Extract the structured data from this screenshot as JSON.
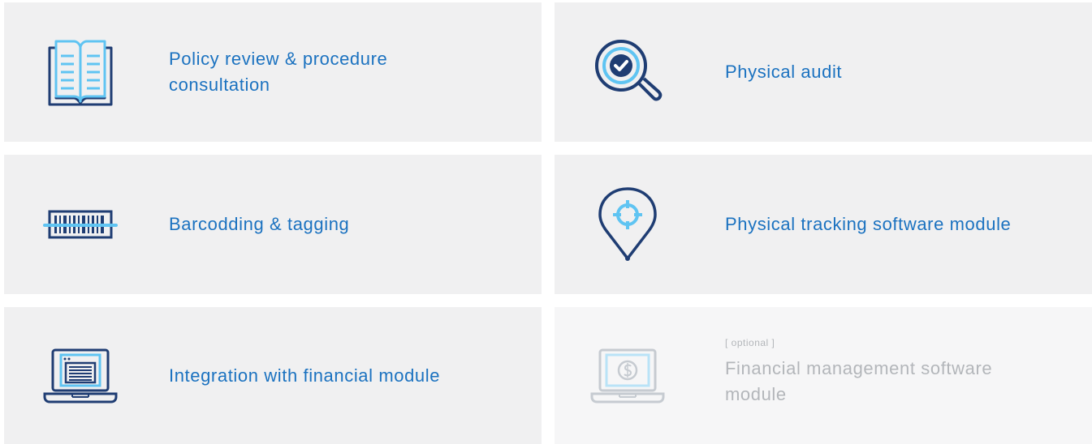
{
  "services": [
    {
      "id": "policy",
      "label": "Policy review & procedure consultation",
      "icon": "open-book-icon"
    },
    {
      "id": "physical-audit",
      "label": "Physical audit",
      "icon": "magnifier-check-icon"
    },
    {
      "id": "barcoding",
      "label": "Barcodding & tagging",
      "icon": "barcode-icon"
    },
    {
      "id": "tracking",
      "label": "Physical tracking software module",
      "icon": "location-pin-icon"
    },
    {
      "id": "integration",
      "label": "Integration with financial module",
      "icon": "laptop-document-icon"
    },
    {
      "id": "financial-management",
      "tag": "[ optional ]",
      "label": "Financial management software module",
      "icon": "laptop-dollar-icon"
    }
  ],
  "colors": {
    "card_bg": "#f0f0f1",
    "label_blue": "#1b72c0",
    "icon_dark": "#1f3d73",
    "icon_light": "#5fc4f2",
    "muted_grey": "#b3b6ba"
  }
}
